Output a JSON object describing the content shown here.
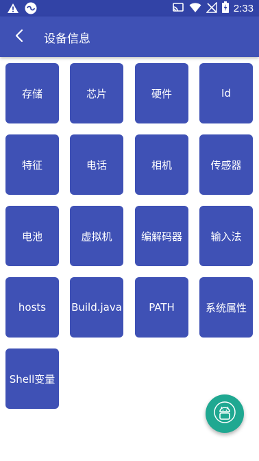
{
  "status_bar": {
    "time": "2:33",
    "left_icons": [
      "warning-icon",
      "sync-app-icon"
    ],
    "right_icons": [
      "cast-icon",
      "wifi-icon",
      "no-signal-icon",
      "battery-charging-icon"
    ]
  },
  "app_bar": {
    "title": "设备信息",
    "back_icon": "back-arrow-icon"
  },
  "tiles": [
    {
      "label": "存储"
    },
    {
      "label": "芯片"
    },
    {
      "label": "硬件"
    },
    {
      "label": "Id"
    },
    {
      "label": "特征"
    },
    {
      "label": "电话"
    },
    {
      "label": "相机"
    },
    {
      "label": "传感器"
    },
    {
      "label": "电池"
    },
    {
      "label": "虚拟机"
    },
    {
      "label": "编解码器"
    },
    {
      "label": "输入法"
    },
    {
      "label": "hosts"
    },
    {
      "label": "Build.java"
    },
    {
      "label": "PATH"
    },
    {
      "label": "系统属性"
    },
    {
      "label": "Shell变量"
    }
  ],
  "fab": {
    "icon": "android-icon"
  },
  "colors": {
    "status_bar": "#3243a6",
    "app_bar": "#3f51b5",
    "tile": "#3f51b5",
    "fab": "#1fa891"
  }
}
